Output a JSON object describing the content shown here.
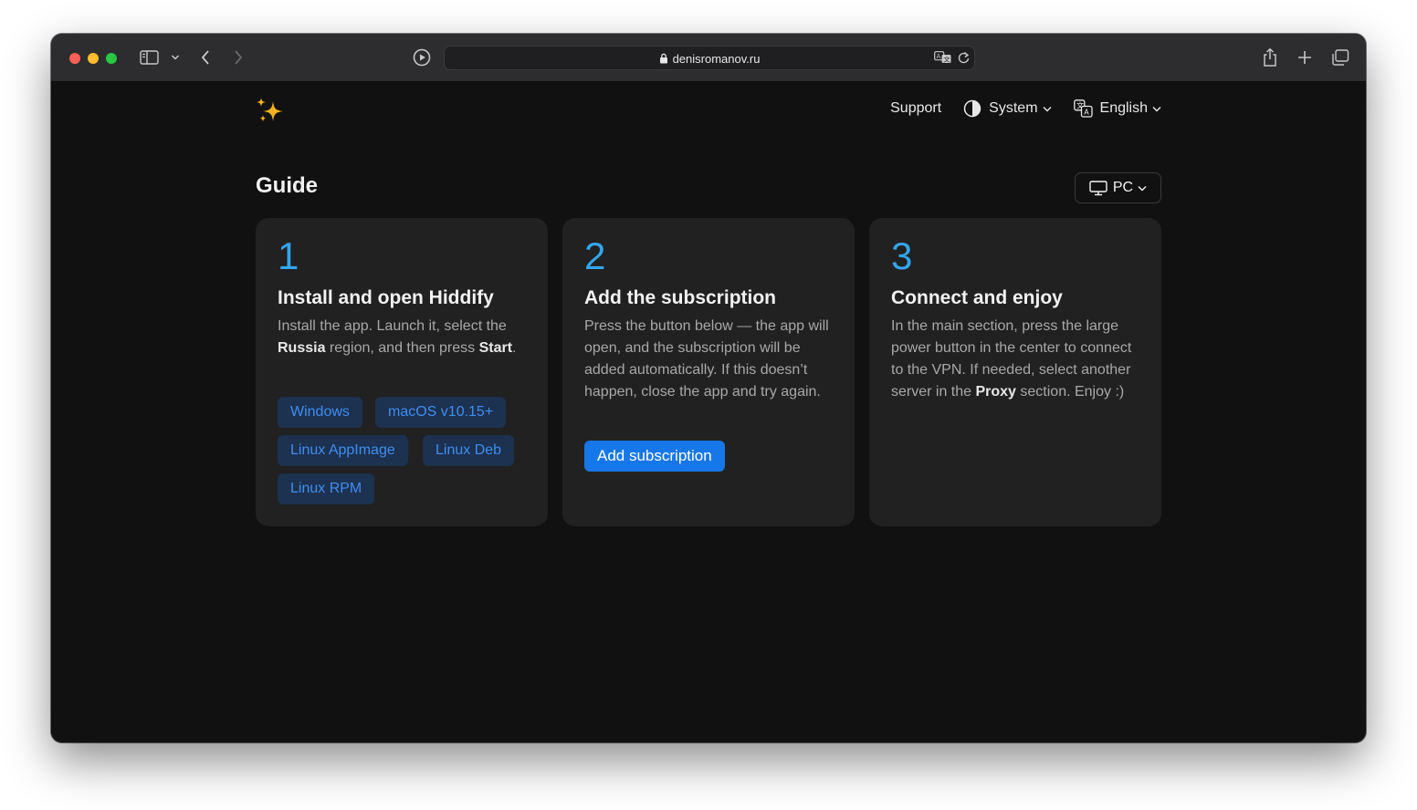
{
  "browser": {
    "url": "denisromanov.ru"
  },
  "nav": {
    "support": "Support",
    "theme": "System",
    "language": "English"
  },
  "guide": {
    "title": "Guide",
    "platform": "PC"
  },
  "steps": [
    {
      "number": "1",
      "title": "Install and open Hiddify",
      "text_parts": [
        "Install the app. Launch it, select the ",
        "Russia",
        " region, and then press ",
        "Start",
        "."
      ],
      "downloads": [
        "Windows",
        "macOS v10.15+",
        "Linux AppImage",
        "Linux Deb",
        "Linux RPM"
      ]
    },
    {
      "number": "2",
      "title": "Add the subscription",
      "text": "Press the button below — the app will open, and the subscription will be added automatically. If this doesn’t happen, close the app and try again.",
      "button": "Add subscription"
    },
    {
      "number": "3",
      "title": "Connect and enjoy",
      "text_parts": [
        "In the main section, press the large power button in the center to connect to the VPN. If needed, select another server in the ",
        "Proxy",
        " section. Enjoy :)"
      ]
    }
  ],
  "colors": {
    "accent": "#33a6f0",
    "primary_button": "#1677e8",
    "download_button_bg": "#1d3150",
    "download_button_text": "#3f8ef0",
    "card_bg": "#212121",
    "page_bg": "#111111"
  }
}
